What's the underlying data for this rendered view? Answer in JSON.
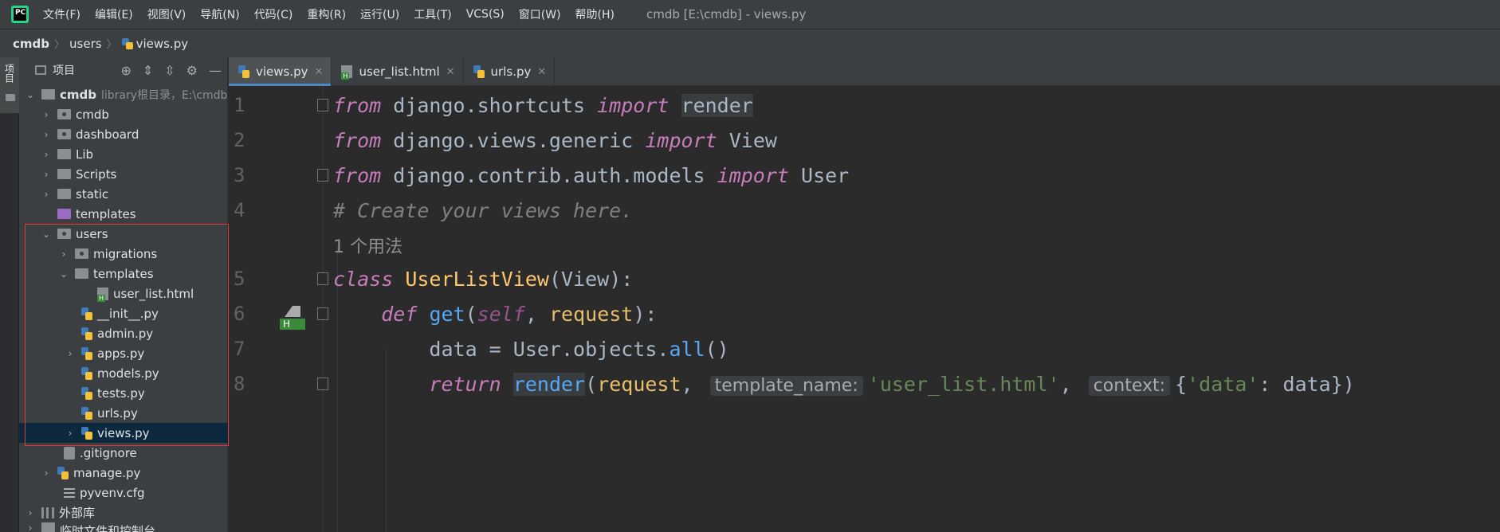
{
  "menubar": {
    "items": [
      "文件(F)",
      "编辑(E)",
      "视图(V)",
      "导航(N)",
      "代码(C)",
      "重构(R)",
      "运行(U)",
      "工具(T)",
      "VCS(S)",
      "窗口(W)",
      "帮助(H)"
    ],
    "window_title": "cmdb [E:\\cmdb] - views.py"
  },
  "breadcrumb": [
    "cmdb",
    "users",
    "views.py"
  ],
  "toolstrip": {
    "project_tab": "项目"
  },
  "project_panel": {
    "title": "项目",
    "root": {
      "name": "cmdb",
      "hint": "library根目录，E:\\cmdb"
    },
    "items": [
      {
        "label": "cmdb"
      },
      {
        "label": "dashboard"
      },
      {
        "label": "Lib"
      },
      {
        "label": "Scripts"
      },
      {
        "label": "static"
      },
      {
        "label": "templates"
      },
      {
        "label": "users"
      },
      {
        "label": "migrations"
      },
      {
        "label": "templates"
      },
      {
        "label": "user_list.html"
      },
      {
        "label": "__init__.py"
      },
      {
        "label": "admin.py"
      },
      {
        "label": "apps.py"
      },
      {
        "label": "models.py"
      },
      {
        "label": "tests.py"
      },
      {
        "label": "urls.py"
      },
      {
        "label": "views.py"
      },
      {
        "label": ".gitignore"
      },
      {
        "label": "manage.py"
      },
      {
        "label": "pyvenv.cfg"
      },
      {
        "label": "外部库"
      },
      {
        "label": "临时文件和控制台"
      }
    ]
  },
  "tabs": [
    {
      "label": "views.py",
      "active": true
    },
    {
      "label": "user_list.html",
      "active": false
    },
    {
      "label": "urls.py",
      "active": false
    }
  ],
  "editor": {
    "line_numbers": [
      "1",
      "2",
      "3",
      "4",
      "5",
      "6",
      "7",
      "8"
    ],
    "line1": {
      "kw": "from",
      "mod": " django.shortcuts ",
      "imp": "import",
      "name": "render"
    },
    "line2": {
      "kw": "from",
      "mod": " django.views.generic ",
      "imp": "import",
      "name": " View"
    },
    "line3": {
      "kw": "from",
      "mod": " django.contrib.auth.models ",
      "imp": "import",
      "name": " User"
    },
    "line4": {
      "comment": "# Create your views here."
    },
    "usages": "1 个用法",
    "line5": {
      "kw": "class",
      "name": "UserListView",
      "rest": "(View):"
    },
    "line6": {
      "kw": "def",
      "name": "get",
      "self": "self",
      "comma": ", ",
      "param": "request",
      "rest": "):"
    },
    "line7": {
      "text": "data = User.objects.",
      "call": "all",
      "rest": "()"
    },
    "line8": {
      "kw": "return",
      "fn": "render",
      "open": "(",
      "param": "request",
      "comma": ", ",
      "hint1": "template_name:",
      "str1": "'user_list.html'",
      "comma2": ", ",
      "hint2": "context:",
      "brace": "{",
      "str2": "'data'",
      "rest": ": data})"
    }
  },
  "colors": {
    "accent": "#4a88c7",
    "selection": "#0d293e",
    "highlight_box": "#e5383b"
  }
}
